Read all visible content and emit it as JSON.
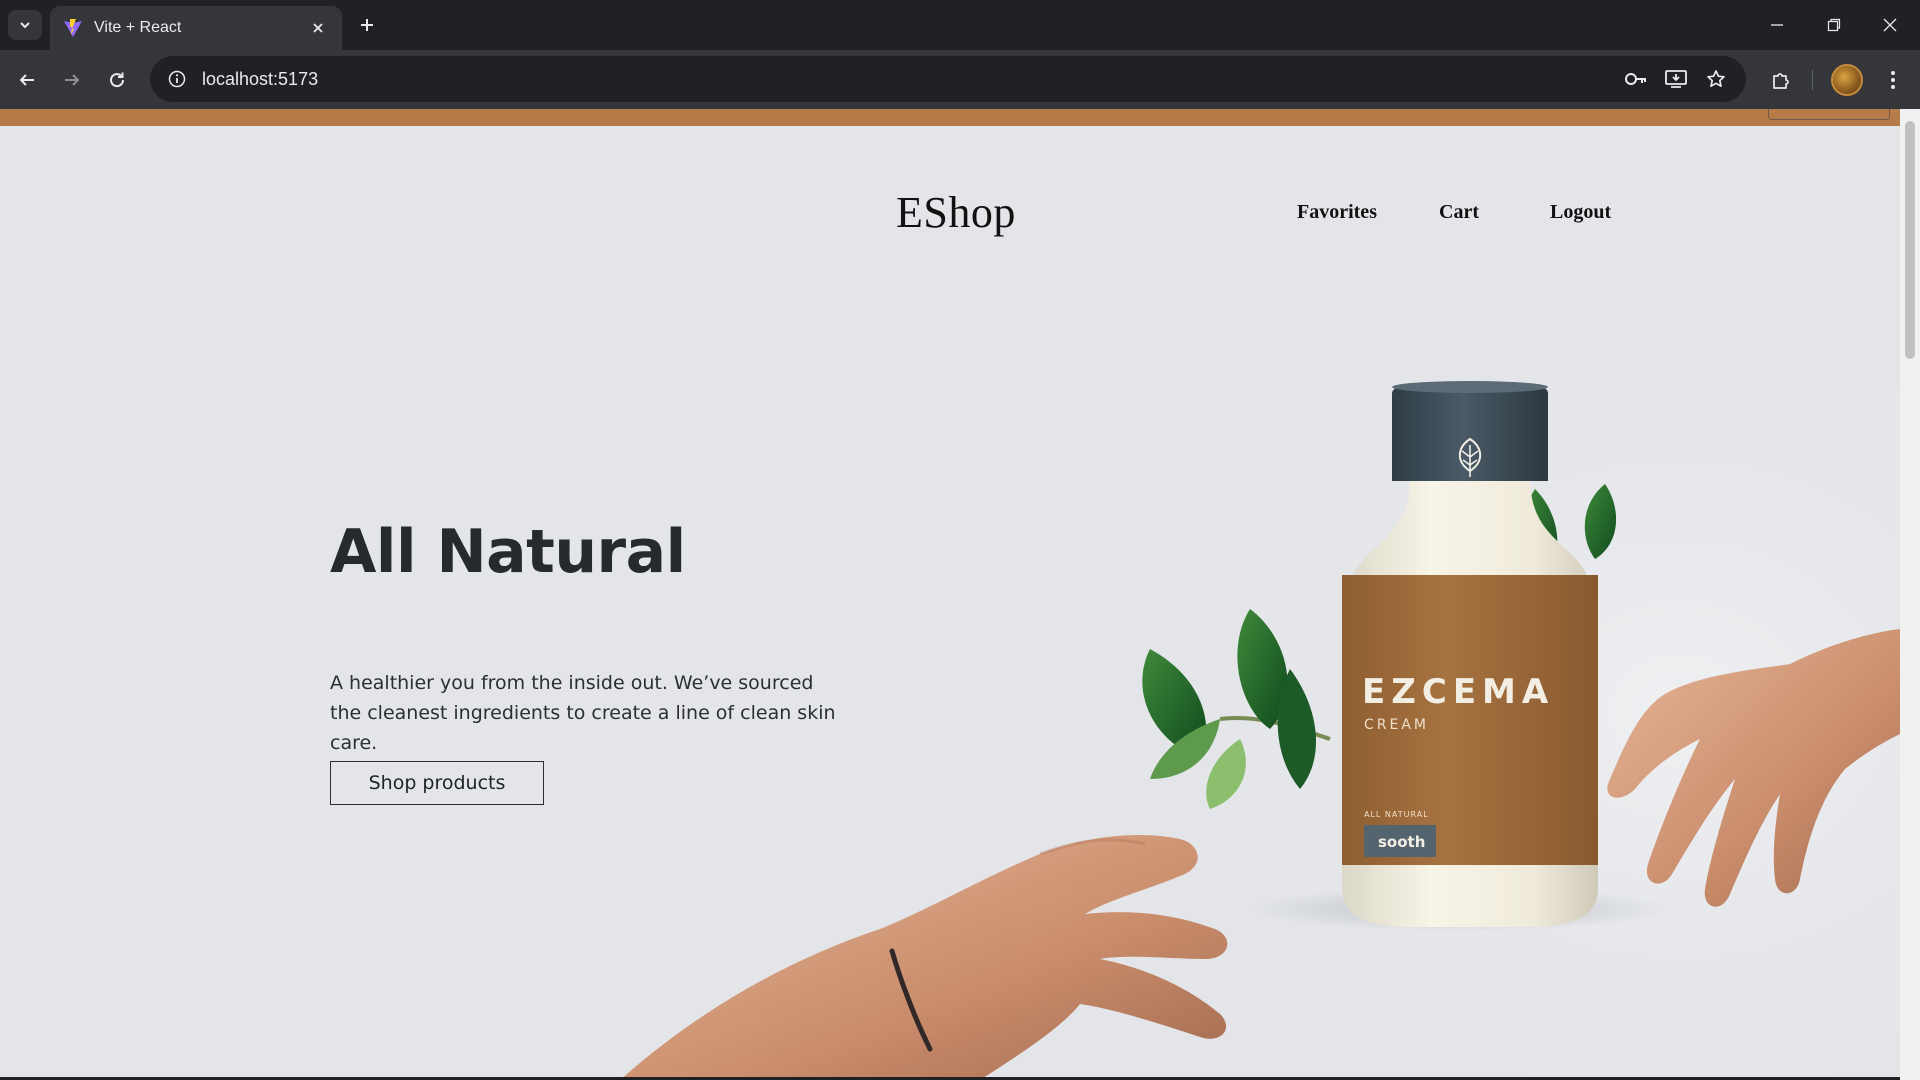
{
  "browser": {
    "tab_title": "Vite + React",
    "url": "localhost:5173",
    "icons": {
      "tab_search": "chevron-down-icon",
      "favicon": "vite-logo-icon",
      "close": "close-icon",
      "new_tab": "plus-icon",
      "back": "arrow-left-icon",
      "forward": "arrow-right-icon",
      "reload": "reload-icon",
      "site_info": "info-icon",
      "password": "key-icon",
      "install": "install-app-icon",
      "bookmark": "star-icon",
      "extensions": "puzzle-icon",
      "menu": "kebab-menu-icon"
    }
  },
  "header": {
    "brand": "EShop",
    "nav": {
      "favorites": "Favorites",
      "cart": "Cart",
      "logout": "Logout"
    }
  },
  "hero": {
    "title": "All Natural",
    "description": "A healthier you from the inside out. We’ve sourced the cleanest ingredients to create a line of clean skin care.",
    "cta": "Shop products",
    "product_label": {
      "name": "EZCEMA",
      "type": "CREAM",
      "tagline": "ALL NATURAL",
      "badge": "sooth"
    }
  },
  "colors": {
    "accent_band": "#b57b49",
    "page_bg": "#e3e5e9",
    "bottle_label": "#a06c3a",
    "bottle_cap": "#3d4c57"
  }
}
